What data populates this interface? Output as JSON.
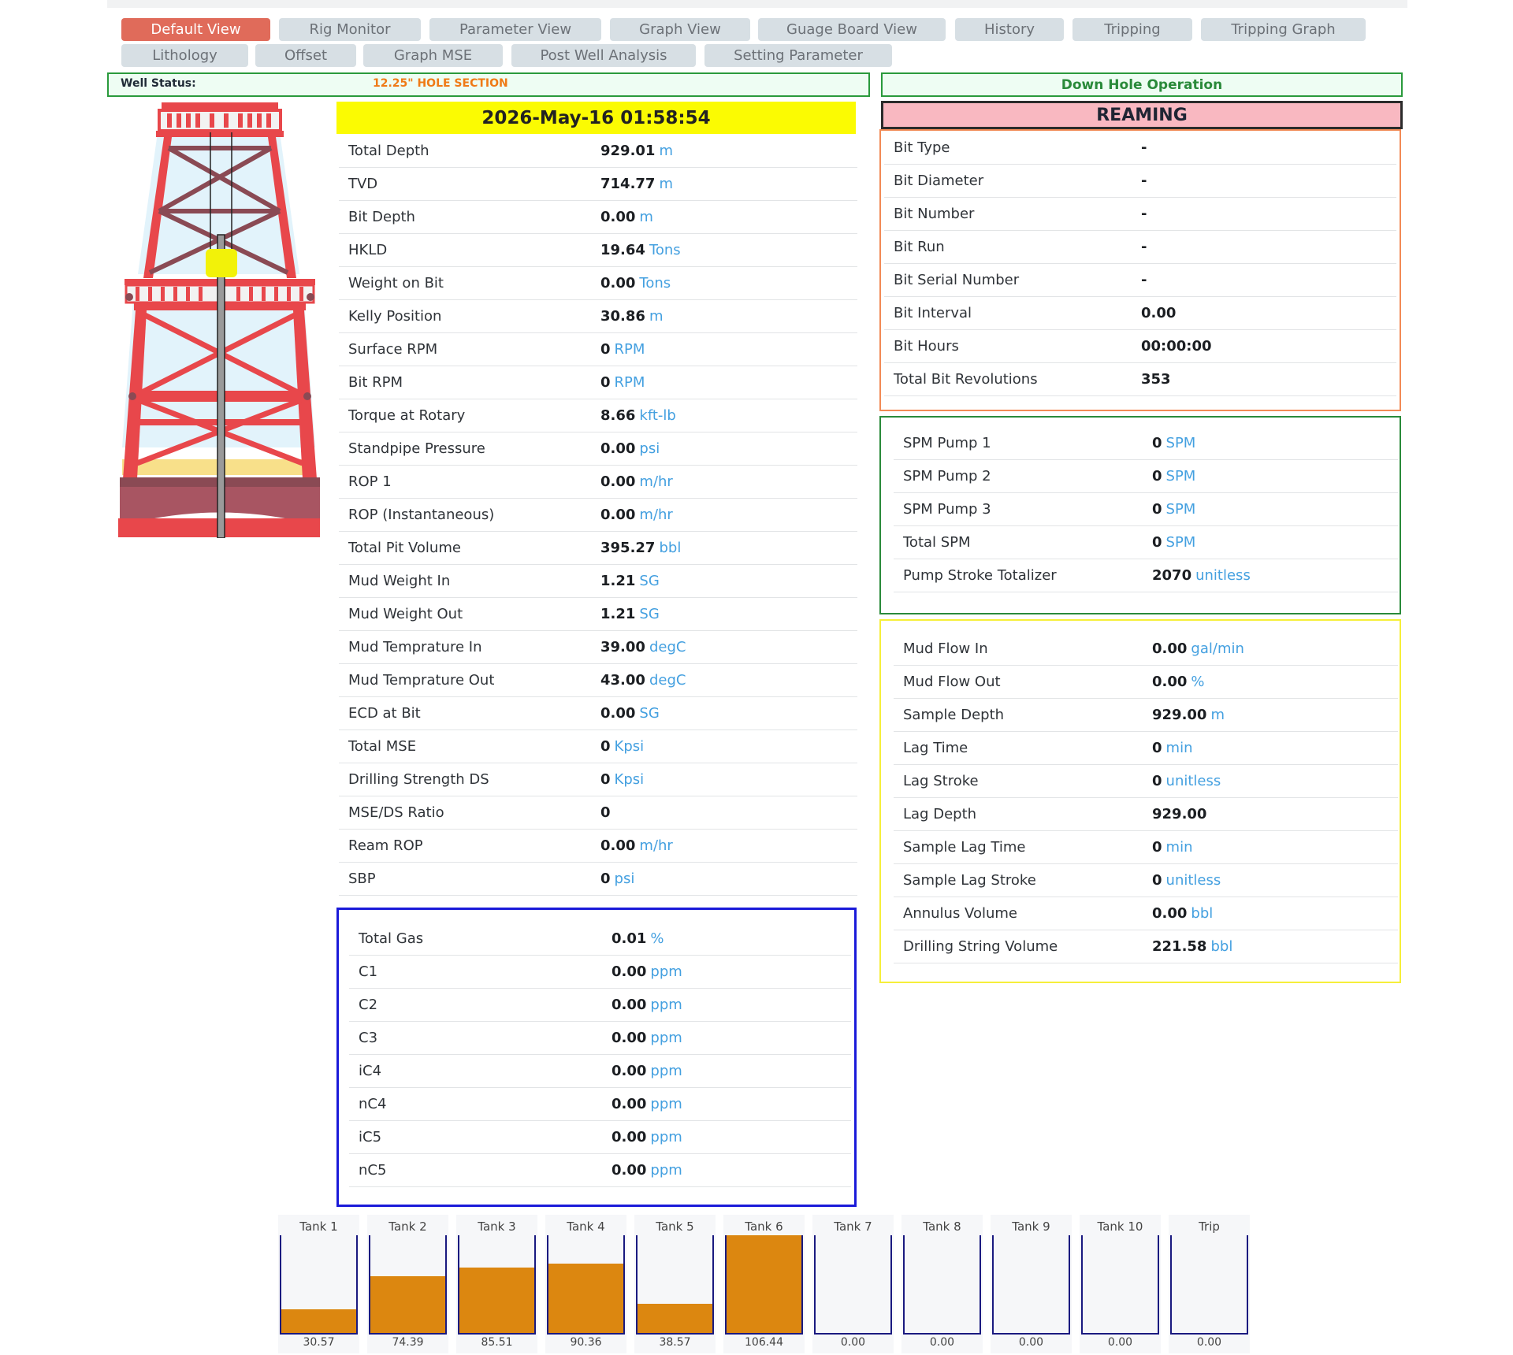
{
  "nav": {
    "row1": [
      "Default View",
      "Rig Monitor",
      "Parameter View",
      "Graph View",
      "Guage Board View",
      "History",
      "Tripping",
      "Tripping Graph"
    ],
    "row2": [
      "Lithology",
      "Offset",
      "Graph MSE",
      "Post Well Analysis",
      "Setting Parameter"
    ],
    "active": "Default View"
  },
  "well_status": {
    "label": "Well Status:",
    "value": "12.25\" HOLE SECTION"
  },
  "datetime": "2026-May-16 01:58:54",
  "down_hole": {
    "title": "Down Hole Operation",
    "operation": "REAMING"
  },
  "params": [
    {
      "label": "Total Depth",
      "value": "929.01",
      "unit": "m"
    },
    {
      "label": "TVD",
      "value": "714.77",
      "unit": "m"
    },
    {
      "label": "Bit Depth",
      "value": "0.00",
      "unit": "m"
    },
    {
      "label": "HKLD",
      "value": "19.64",
      "unit": "Tons"
    },
    {
      "label": "Weight on Bit",
      "value": "0.00",
      "unit": "Tons"
    },
    {
      "label": "Kelly Position",
      "value": "30.86",
      "unit": "m"
    },
    {
      "label": "Surface RPM",
      "value": "0",
      "unit": "RPM"
    },
    {
      "label": "Bit RPM",
      "value": "0",
      "unit": "RPM"
    },
    {
      "label": "Torque at Rotary",
      "value": "8.66",
      "unit": "kft-lb"
    },
    {
      "label": "Standpipe Pressure",
      "value": "0.00",
      "unit": "psi"
    },
    {
      "label": "ROP 1",
      "value": "0.00",
      "unit": "m/hr"
    },
    {
      "label": "ROP (Instantaneous)",
      "value": "0.00",
      "unit": "m/hr"
    },
    {
      "label": "Total Pit Volume",
      "value": "395.27",
      "unit": "bbl"
    },
    {
      "label": "Mud Weight In",
      "value": "1.21",
      "unit": "SG"
    },
    {
      "label": "Mud Weight Out",
      "value": "1.21",
      "unit": "SG"
    },
    {
      "label": "Mud Temprature In",
      "value": "39.00",
      "unit": "degC"
    },
    {
      "label": "Mud Temprature Out",
      "value": "43.00",
      "unit": "degC"
    },
    {
      "label": "ECD at Bit",
      "value": "0.00",
      "unit": "SG"
    },
    {
      "label": "Total MSE",
      "value": "0",
      "unit": "Kpsi"
    },
    {
      "label": "Drilling Strength DS",
      "value": "0",
      "unit": "Kpsi"
    },
    {
      "label": "MSE/DS Ratio",
      "value": "0",
      "unit": ""
    },
    {
      "label": "Ream ROP",
      "value": "0.00",
      "unit": "m/hr"
    },
    {
      "label": "SBP",
      "value": "0",
      "unit": "psi"
    }
  ],
  "gas": [
    {
      "label": "Total Gas",
      "value": "0.01",
      "unit": "%"
    },
    {
      "label": "C1",
      "value": "0.00",
      "unit": "ppm"
    },
    {
      "label": "C2",
      "value": "0.00",
      "unit": "ppm"
    },
    {
      "label": "C3",
      "value": "0.00",
      "unit": "ppm"
    },
    {
      "label": "iC4",
      "value": "0.00",
      "unit": "ppm"
    },
    {
      "label": "nC4",
      "value": "0.00",
      "unit": "ppm"
    },
    {
      "label": "iC5",
      "value": "0.00",
      "unit": "ppm"
    },
    {
      "label": "nC5",
      "value": "0.00",
      "unit": "ppm"
    }
  ],
  "bit": [
    {
      "label": "Bit Type",
      "value": "-",
      "unit": ""
    },
    {
      "label": "Bit Diameter",
      "value": "-",
      "unit": ""
    },
    {
      "label": "Bit Number",
      "value": "-",
      "unit": ""
    },
    {
      "label": "Bit Run",
      "value": "-",
      "unit": ""
    },
    {
      "label": "Bit Serial Number",
      "value": "-",
      "unit": ""
    },
    {
      "label": "Bit Interval",
      "value": "0.00",
      "unit": ""
    },
    {
      "label": "Bit Hours",
      "value": "00:00:00",
      "unit": ""
    },
    {
      "label": "Total Bit Revolutions",
      "value": "353",
      "unit": ""
    }
  ],
  "pumps": [
    {
      "label": "SPM Pump 1",
      "value": "0",
      "unit": "SPM"
    },
    {
      "label": "SPM Pump 2",
      "value": "0",
      "unit": "SPM"
    },
    {
      "label": "SPM Pump 3",
      "value": "0",
      "unit": "SPM"
    },
    {
      "label": "Total SPM",
      "value": "0",
      "unit": "SPM"
    },
    {
      "label": "Pump Stroke Totalizer",
      "value": "2070",
      "unit": "unitless"
    }
  ],
  "flow": [
    {
      "label": "Mud Flow In",
      "value": "0.00",
      "unit": "gal/min"
    },
    {
      "label": "Mud Flow Out",
      "value": "0.00",
      "unit": "%"
    },
    {
      "label": "Sample Depth",
      "value": "929.00",
      "unit": "m"
    },
    {
      "label": "Lag Time",
      "value": "0",
      "unit": "min"
    },
    {
      "label": "Lag Stroke",
      "value": "0",
      "unit": "unitless"
    },
    {
      "label": "Lag Depth",
      "value": "929.00",
      "unit": ""
    },
    {
      "label": "Sample Lag Time",
      "value": "0",
      "unit": "min"
    },
    {
      "label": "Sample Lag Stroke",
      "value": "0",
      "unit": "unitless"
    },
    {
      "label": "Annulus Volume",
      "value": "0.00",
      "unit": "bbl"
    },
    {
      "label": "Drilling String Volume",
      "value": "221.58",
      "unit": "bbl"
    }
  ],
  "tanks": [
    {
      "label": "Tank 1",
      "value": "30.57",
      "level_pct": 24
    },
    {
      "label": "Tank 2",
      "value": "74.39",
      "level_pct": 58
    },
    {
      "label": "Tank 3",
      "value": "85.51",
      "level_pct": 67
    },
    {
      "label": "Tank 4",
      "value": "90.36",
      "level_pct": 71
    },
    {
      "label": "Tank 5",
      "value": "38.57",
      "level_pct": 30
    },
    {
      "label": "Tank 6",
      "value": "106.44",
      "level_pct": 100
    },
    {
      "label": "Tank 7",
      "value": "0.00",
      "level_pct": 0
    },
    {
      "label": "Tank 8",
      "value": "0.00",
      "level_pct": 0
    },
    {
      "label": "Tank 9",
      "value": "0.00",
      "level_pct": 0
    },
    {
      "label": "Tank 10",
      "value": "0.00",
      "level_pct": 0
    },
    {
      "label": "Trip",
      "value": "0.00",
      "level_pct": 0
    }
  ],
  "colors": {
    "accent": "#e06b5a",
    "unit": "#44a0e0",
    "tank_fill": "#dc8710",
    "status_orange": "#ef7a16"
  },
  "icons": {
    "rig": "drilling-rig-illustration"
  }
}
